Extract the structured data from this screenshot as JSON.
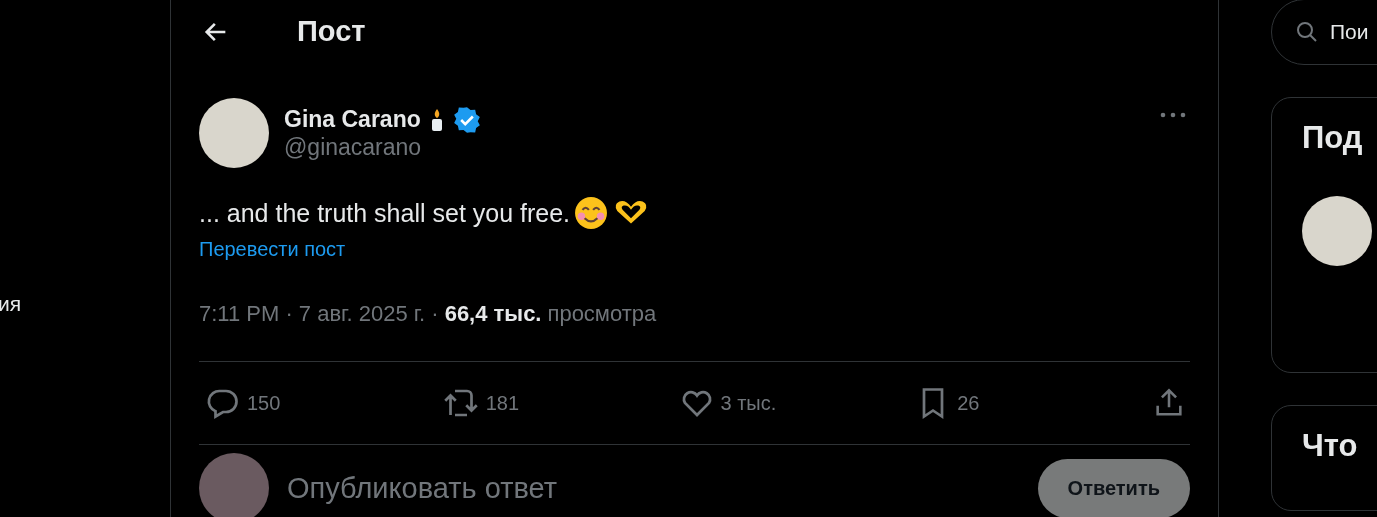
{
  "sidebar": {
    "items": [
      {
        "label": "ия"
      }
    ]
  },
  "header": {
    "title": "Пост"
  },
  "post": {
    "author": {
      "name": "Gina Carano",
      "handle": "@ginacarano",
      "verified": true
    },
    "text": "... and the truth shall set you free.",
    "translate_link": "Перевести пост",
    "time": "7:11 PM · 7 авг. 2025 г. ·",
    "views": "66,4 тыс.",
    "views_label": "просмотра",
    "actions": [
      {
        "kind": "reply",
        "count": "150"
      },
      {
        "kind": "repost",
        "count": "181"
      },
      {
        "kind": "like",
        "count": "3 тыс."
      },
      {
        "kind": "bookmark",
        "count": "26"
      },
      {
        "kind": "share"
      }
    ]
  },
  "reply": {
    "placeholder": "Опубликовать ответ",
    "button": "Ответить"
  },
  "right": {
    "search": {
      "placeholder": "Пои"
    },
    "cards": [
      {
        "title": "Под"
      },
      {
        "title": "Что"
      }
    ]
  }
}
